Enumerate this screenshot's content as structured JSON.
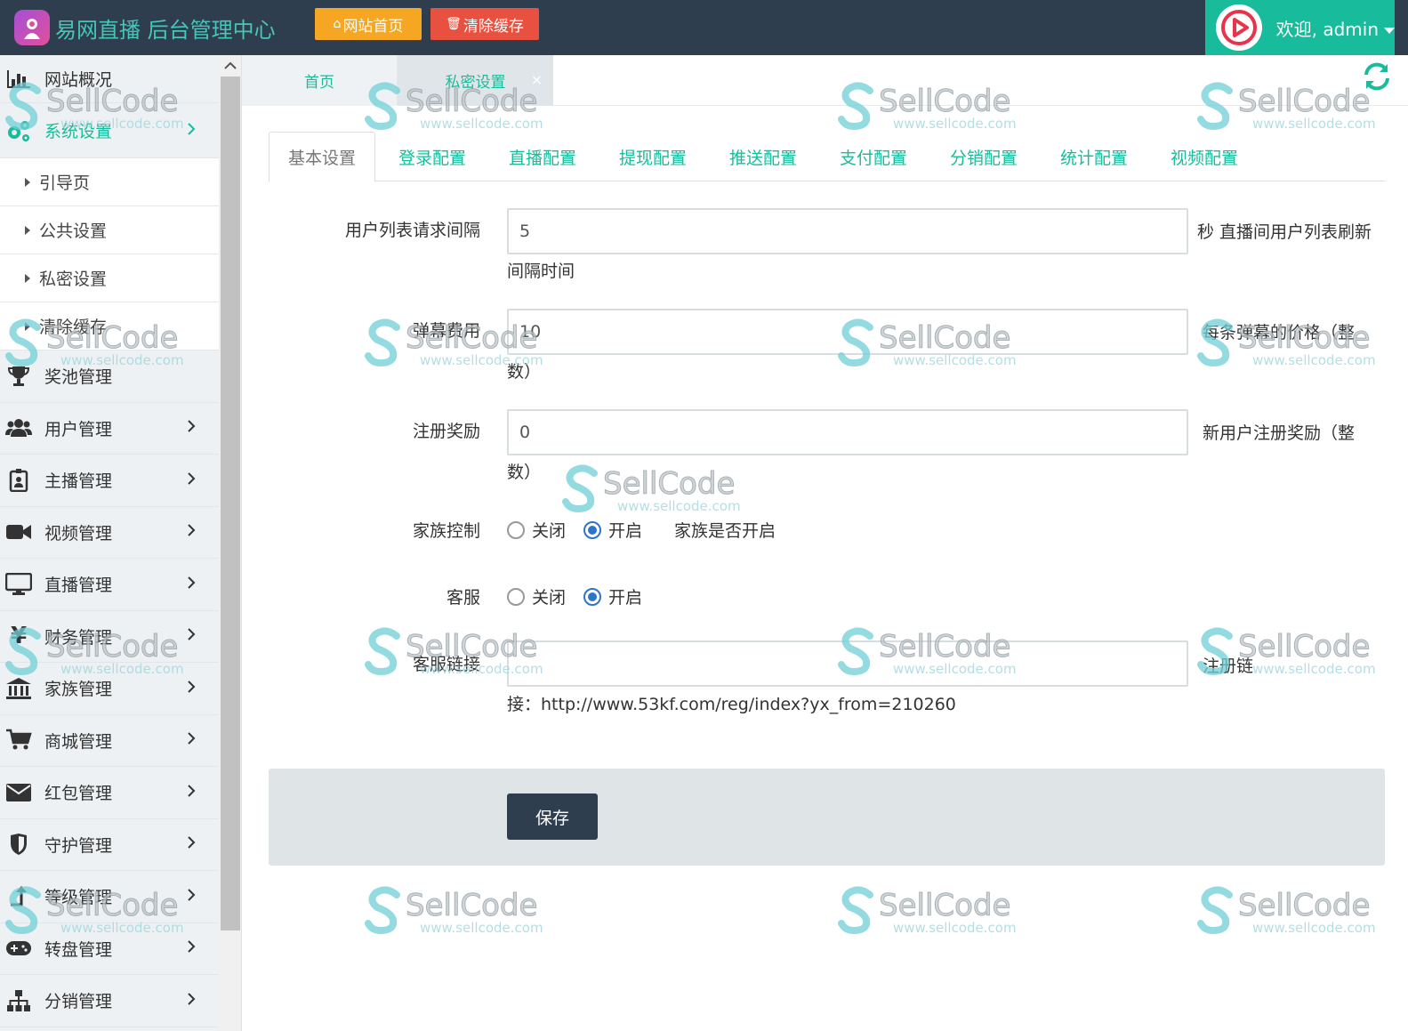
{
  "app": {
    "title": "易网直播 后台管理中心",
    "home_button": "网站首页",
    "clear_cache_button": "清除缓存",
    "welcome": "欢迎, admin"
  },
  "colors": {
    "topbar": "#2f3e4f",
    "accent": "#18bc9c",
    "home_button": "#f5a623",
    "clear_button": "#e8513f",
    "radio_selected": "#2e74c9"
  },
  "sidebar": {
    "items": [
      {
        "label": "网站概况",
        "icon": "bar-chart-icon"
      },
      {
        "label": "系统设置",
        "icon": "gears-icon",
        "active": true
      },
      {
        "label": "引导页",
        "sub": true
      },
      {
        "label": "公共设置",
        "sub": true
      },
      {
        "label": "私密设置",
        "sub": true
      },
      {
        "label": "清除缓存",
        "sub": true
      },
      {
        "label": "奖池管理",
        "icon": "trophy-icon"
      },
      {
        "label": "用户管理",
        "icon": "users-icon"
      },
      {
        "label": "主播管理",
        "icon": "badge-icon"
      },
      {
        "label": "视频管理",
        "icon": "video-camera-icon"
      },
      {
        "label": "直播管理",
        "icon": "monitor-icon"
      },
      {
        "label": "财务管理",
        "icon": "yen-icon"
      },
      {
        "label": "家族管理",
        "icon": "bank-icon"
      },
      {
        "label": "商城管理",
        "icon": "cart-icon"
      },
      {
        "label": "红包管理",
        "icon": "envelope-icon"
      },
      {
        "label": "守护管理",
        "icon": "shield-icon"
      },
      {
        "label": "等级管理",
        "icon": "level-up-icon"
      },
      {
        "label": "转盘管理",
        "icon": "gamepad-icon"
      },
      {
        "label": "分销管理",
        "icon": "sitemap-icon"
      }
    ]
  },
  "tabs": [
    {
      "label": "首页"
    },
    {
      "label": "私密设置",
      "active": true,
      "close": "×"
    }
  ],
  "subtabs": [
    "基本设置",
    "登录配置",
    "直播配置",
    "提现配置",
    "推送配置",
    "支付配置",
    "分销配置",
    "统计配置",
    "视频配置"
  ],
  "form": {
    "user_list_interval": {
      "label": "用户列表请求间隔",
      "value": "5",
      "help_line1": "秒 直播间用户列表刷新",
      "help_line2": "间隔时间"
    },
    "barrage_fee": {
      "label": "弹幕费用",
      "value": "10",
      "help_line1": "每条弹幕的价格（整",
      "help_line2": "数）"
    },
    "register_reward": {
      "label": "注册奖励",
      "value": "0",
      "help_line1": "新用户注册奖励（整",
      "help_line2": "数）"
    },
    "family_control": {
      "label": "家族控制",
      "options": [
        "关闭",
        "开启"
      ],
      "selected": "开启",
      "help": "家族是否开启"
    },
    "customer_service": {
      "label": "客服",
      "options": [
        "关闭",
        "开启"
      ],
      "selected": "开启"
    },
    "service_link": {
      "label": "客服链接",
      "value": "",
      "help_line1": "注册链",
      "help_line2": "接：http://www.53kf.com/reg/index?yx_from=210260"
    },
    "save_label": "保存"
  },
  "watermark": {
    "brand": "SellCode",
    "url": "www.sellcode.com"
  }
}
